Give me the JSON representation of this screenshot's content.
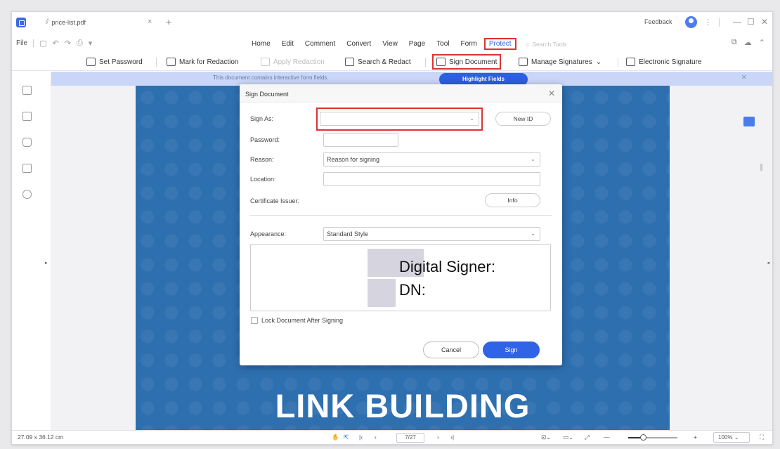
{
  "window": {
    "tab_title": "price-list.pdf",
    "feedback": "Feedback"
  },
  "menu": {
    "file": "File",
    "items": [
      "Home",
      "Edit",
      "Comment",
      "Convert",
      "View",
      "Page",
      "Tool",
      "Form",
      "Protect"
    ],
    "active": "Protect",
    "search_placeholder": "Search Tools"
  },
  "toolbar": {
    "set_password": "Set Password",
    "mark_for_redaction": "Mark for Redaction",
    "apply_redaction": "Apply Redaction",
    "search_redact": "Search & Redact",
    "sign_document": "Sign Document",
    "manage_signatures": "Manage Signatures",
    "electronic_signature": "Electronic Signature"
  },
  "notice": {
    "text": "This document contains interactive form fields.",
    "button": "Highlight Fields"
  },
  "page": {
    "heading": "LINK BUILDING"
  },
  "dialog": {
    "title": "Sign Document",
    "sign_as_label": "Sign As:",
    "sign_as_value": "",
    "new_id": "New ID",
    "password_label": "Password:",
    "reason_label": "Reason:",
    "reason_value": "Reason for signing",
    "location_label": "Location:",
    "location_value": "",
    "cert_issuer_label": "Certificate Issuer:",
    "info": "Info",
    "appearance_label": "Appearance:",
    "appearance_value": "Standard Style",
    "preview_line1": "Digital Signer:",
    "preview_line2": "DN:",
    "lock_label": "Lock Document After Signing",
    "lock_checked": false,
    "cancel": "Cancel",
    "sign": "Sign"
  },
  "statusbar": {
    "dimensions": "27.09 x 36.12 cm",
    "page_indicator": "7/27",
    "zoom": "100%",
    "zoom_level_fraction": 0.3
  },
  "colors": {
    "accent": "#3163e6",
    "highlight_red": "#d93535",
    "page_blue": "#2e6fb0"
  }
}
